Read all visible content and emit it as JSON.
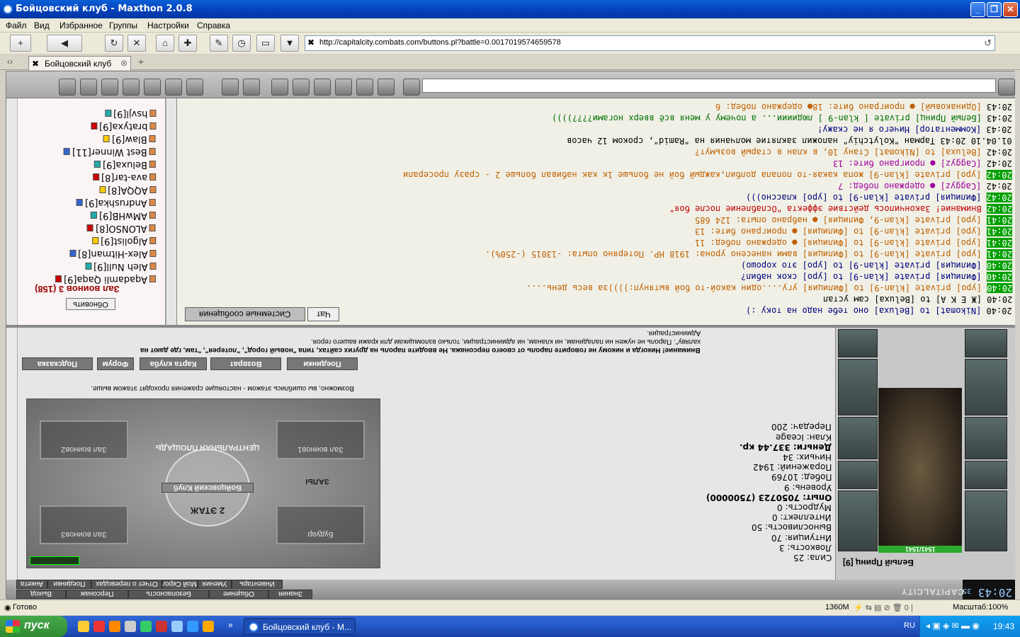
{
  "window": {
    "title": "Бойцовский клуб - Maxthon 2.0.8"
  },
  "menu": [
    "Файл",
    "Вид",
    "Избранное",
    "Группы",
    "Настройки",
    "Справка"
  ],
  "address": {
    "url": "http://capitalcity.combats.com/buttons.pl?battle=0.0017019574659578"
  },
  "tab": {
    "label": "Бойцовский клуб"
  },
  "chat": {
    "tabs": [
      "Чат",
      "Системные сообщения"
    ],
    "lines": [
      {
        "time": "20:43",
        "tagged": false,
        "text": "[Одинаковый] ● проиграно бите: 18● одержано побед: 6",
        "cls": "c-or"
      },
      {
        "time": "20:43",
        "tagged": false,
        "text": "[Белый Принц] private [ klan-9 ] людииии... а почему у меня всё вверх ногами????))))",
        "cls": "c-gr"
      },
      {
        "time": "20:43",
        "tagged": false,
        "text": "[Комментатор] Ничего я не скажу!",
        "cls": "c-bl"
      },
      {
        "time": "01.04.10 20:43",
        "tagged": false,
        "text": "Тарман \"Kolytchiy\" наложил заклятие молчания на \"Ramid\", сроком 12 часов",
        "cls": ""
      },
      {
        "time": "20:42",
        "tagged": false,
        "text": "[Beluxa] to [Nikomat] Стану 10, в клан в старый возьмут?",
        "cls": "c-or"
      },
      {
        "time": "20:42",
        "tagged": false,
        "text": "[Caggyz] ● проиграно бите: 13",
        "cls": "c-pk"
      },
      {
        "time": "20:42",
        "tagged": true,
        "text": "[ypo] private [klan-9] жопа какая-то попала долбил,каждый бой не больше 1к как набивал больше 2 - сразу просерали",
        "cls": "c-or"
      },
      {
        "time": "20:42",
        "tagged": false,
        "text": "[Caggyz] ● одержано побед: 7",
        "cls": "c-pk"
      },
      {
        "time": "20:42",
        "tagged": true,
        "text": "[Филиция] private [klan-9] to [ypo] классно)))",
        "cls": "c-bl"
      },
      {
        "time": "20:42",
        "tagged": true,
        "text": "Внимание! Закончилось действие эффекта \"Ослабление после боя\"",
        "cls": "c-rd"
      },
      {
        "time": "20:41",
        "tagged": true,
        "text": "[ypo] private [klan-9, Филиция] ● набрано опыта: 124 685",
        "cls": "c-or"
      },
      {
        "time": "20:41",
        "tagged": true,
        "text": "[ypo] private [klan-9] to [Филиция] ● проиграно бите: 13",
        "cls": "c-or"
      },
      {
        "time": "20:41",
        "tagged": true,
        "text": "[ypo] private [klan-9] to [Филиция] ● одержано побед: 11",
        "cls": "c-or"
      },
      {
        "time": "20:41",
        "tagged": true,
        "text": "[ypo] private [klan-9] to [Филиция] вами нанесено урона: 1918 HP. Потеряно опыта: -13015 (-250%).",
        "cls": "c-or"
      },
      {
        "time": "20:40",
        "tagged": true,
        "text": "[Филиция] private [klan-9] to [ypo] это хорошо)",
        "cls": "c-bl"
      },
      {
        "time": "20:40",
        "tagged": true,
        "text": "[Филиция] private [klan-9] to [ypo] скок набил?",
        "cls": "c-bl"
      },
      {
        "time": "20:40",
        "tagged": true,
        "text": "[ypo] private [klan-9] to [Филиция] угу....один какой-то бой вытянул:))))за весь день....",
        "cls": "c-or"
      },
      {
        "time": "20:40",
        "tagged": false,
        "text": "[Ж Е К А] to [Beluxa] сам устал",
        "cls": ""
      },
      {
        "time": "20:40",
        "tagged": false,
        "text": "[Nikomat] to [Beluxa] оно тебе надо на току :)",
        "cls": "c-bl"
      }
    ]
  },
  "users": {
    "hall": "Зал воинов 3 (158)",
    "refresh": "Обновить",
    "list": [
      {
        "name": "hsvjl",
        "lvl": "[9]"
      },
      {
        "name": "bratyxa",
        "lvl": "[9]"
      },
      {
        "name": "Blaw",
        "lvl": "[9]"
      },
      {
        "name": "Best Winner",
        "lvl": "[11]"
      },
      {
        "name": "Beluxa",
        "lvl": "[9]"
      },
      {
        "name": "ava-tar",
        "lvl": "[8]"
      },
      {
        "name": "AQQA",
        "lvl": "[8]"
      },
      {
        "name": "Andrushka",
        "lvl": "[9]"
      },
      {
        "name": "AMwHB",
        "lvl": "[9]"
      },
      {
        "name": "ALONSO",
        "lvl": "[8]"
      },
      {
        "name": "Algolist",
        "lvl": "[9]"
      },
      {
        "name": "Alex-Hitman",
        "lvl": "[8]"
      },
      {
        "name": "Aleh Null",
        "lvl": "[9]"
      },
      {
        "name": "Aqadamli Qaqa",
        "lvl": "[9]"
      }
    ]
  },
  "character": {
    "name": "Белый Принц [9]",
    "hp": "1541/1541",
    "stats": [
      "Сила: 25",
      "Ловкость: 3",
      "Интуиция: 70",
      "Выносливость: 50",
      "Интеллект: 0",
      "Мудрость: 0",
      "Опыт: 7050723 (7500000)",
      "Уровень: 9",
      "Побед: 10769",
      "Поражений: 1942",
      "Ничьих: 34",
      "Деньги: 337.44 кр.",
      "Клан: Iceage",
      "Передач: 200"
    ]
  },
  "lower": {
    "warning1": "Внимание! Никогда и никому не говорите пароль от своего персонажа. Не вводите пароль на других сайтах, типа \"новый город\", \"лотерея\", \"там, где дают на",
    "warning2": "халяву\". Пароль не нужен ни паладинам, ни кланам, ни администрации, только взломщикам для кражи вашего героя.",
    "warning3": "Администрация.",
    "floorhint": "Возможно, вы ошиблись этажом - настоящие сражения проходят этажом выше.",
    "buttons": [
      "Поединки",
      "Возврат",
      "Карта клуба",
      "Форум",
      "Подсказка"
    ],
    "map": {
      "rooms": [
        "Зал воинов2",
        "Зал воинов1",
        "Зал воинов3",
        "Будуар"
      ],
      "center": "ЦЕНТРАЛЬНАЯ ПЛОЩАДЬ",
      "club": "Бойцовский Клуб",
      "floor": "2 ЭТАЖ",
      "halls": "ЗАЛЫ"
    }
  },
  "footer": {
    "tabs1": [
      "Инвентарь",
      "Умения",
      "Мой Скролл",
      "Отчет о переводах",
      "Поединки",
      "Анкета"
    ],
    "tabs2": [
      "Знания",
      "Общение",
      "Безопасность",
      "Персонаж",
      "Выход"
    ],
    "clock": "20:43",
    "clocksec": "35",
    "capital": "CAPITALCITY"
  },
  "status": {
    "text": "Готово",
    "mem": "1360M",
    "zoom": "Масштаб:100%"
  },
  "taskbar": {
    "start": "пуск",
    "item": "Бойцовский клуб - М...",
    "lang": "RU",
    "time": "19:43"
  }
}
